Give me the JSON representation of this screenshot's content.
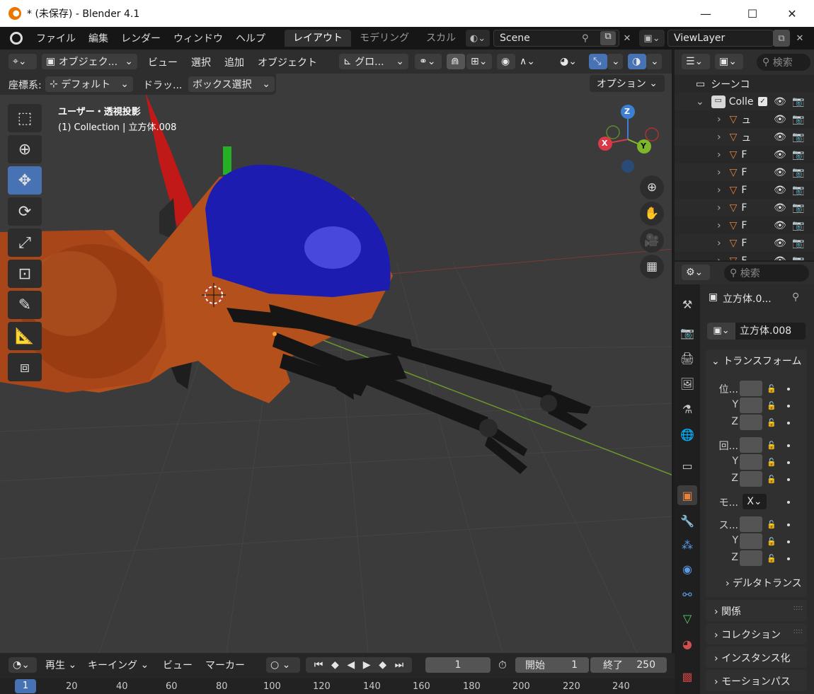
{
  "window": {
    "title": "* (未保存) - Blender 4.1",
    "minimize": "—",
    "maximize": "☐",
    "close": "✕"
  },
  "menu": {
    "items": [
      "ファイル",
      "編集",
      "レンダー",
      "ウィンドウ",
      "ヘルプ"
    ]
  },
  "workspaces": {
    "tabs": [
      "レイアウト",
      "モデリング",
      "スカル"
    ],
    "active": "レイアウト"
  },
  "scene": {
    "name": "Scene",
    "view_layer": "ViewLayer"
  },
  "viewport": {
    "header": {
      "mode": "オブジェク...",
      "menus": [
        "ビュー",
        "選択",
        "追加",
        "オブジェクト"
      ],
      "transform": "グロ..."
    },
    "header2": {
      "coord_label": "座標系:",
      "coord_value": "デフォルト",
      "drag_label": "ドラッ...",
      "drag_value": "ボックス選択"
    },
    "options": "オプション",
    "overlay": {
      "view_name": "ユーザー・透視投影",
      "object_info": "(1) Collection | 立方体.008"
    },
    "gizmo": {
      "x": "X",
      "y": "Y",
      "z": "Z"
    }
  },
  "timeline": {
    "play": "再生",
    "keying": "キーイング",
    "view": "ビュー",
    "marker": "マーカー",
    "current_frame": "1",
    "start_label": "開始",
    "start": "1",
    "end_label": "終了",
    "end": "250",
    "ruler": [
      "1",
      "20",
      "40",
      "60",
      "80",
      "100",
      "120",
      "140",
      "160",
      "180",
      "200",
      "220",
      "240"
    ]
  },
  "outliner": {
    "search_placeholder": "検索",
    "root": "シーンコ",
    "collection": "Colle",
    "objects": [
      "ュ",
      "ュ",
      "F",
      "F",
      "F",
      "F",
      "F",
      "F",
      "F"
    ]
  },
  "properties": {
    "search_placeholder": "検索",
    "object_name": "立方体.0...",
    "object_field": "立方体.008",
    "transform_title": "トランスフォーム",
    "location_label": "位...",
    "rotation_label": "回...",
    "mode_label": "モ...",
    "mode_value": "X",
    "scale_label": "ス...",
    "y": "Y",
    "z": "Z",
    "delta": "デルタトランス",
    "panels": [
      "関係",
      "コレクション",
      "インスタンス化",
      "モーションパス"
    ]
  }
}
